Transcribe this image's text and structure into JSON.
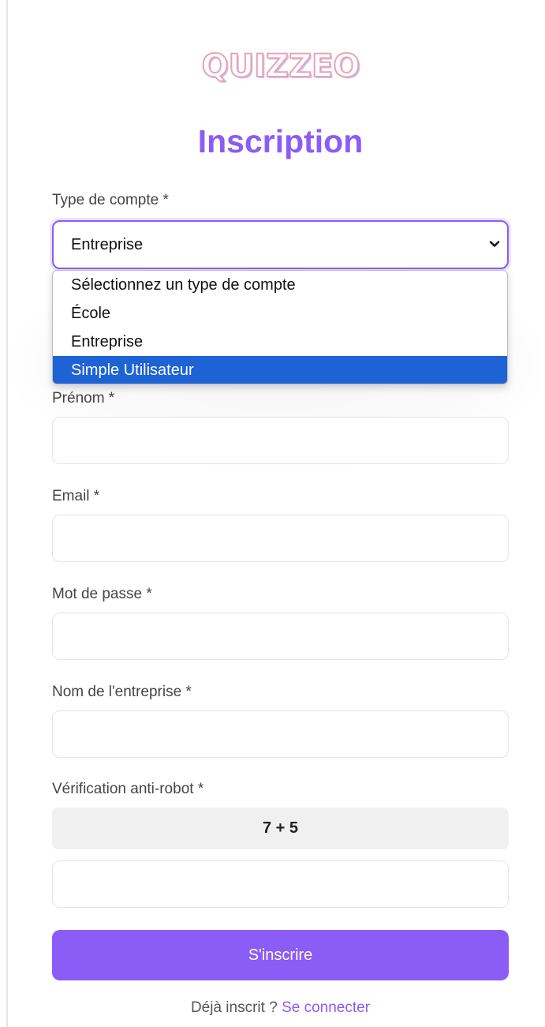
{
  "logo": {
    "text": "QUIZZEO"
  },
  "title": "Inscription",
  "account_type": {
    "label": "Type de compte *",
    "selected": "Entreprise",
    "options": [
      "Sélectionnez un type de compte",
      "École",
      "Entreprise",
      "Simple Utilisateur"
    ],
    "highlighted": "Simple Utilisateur"
  },
  "fields": {
    "prenom": {
      "label": "Prénom *",
      "value": ""
    },
    "email": {
      "label": "Email *",
      "value": ""
    },
    "password": {
      "label": "Mot de passe *",
      "value": ""
    },
    "company": {
      "label": "Nom de l'entreprise *",
      "value": ""
    },
    "captcha": {
      "label": "Vérification anti-robot *",
      "question": "7 + 5",
      "value": ""
    }
  },
  "submit_label": "S'inscrire",
  "footer": {
    "text": "Déjà inscrit ? ",
    "link": "Se connecter"
  },
  "colors": {
    "accent": "#8b5cf6",
    "highlight": "#1e63d6"
  }
}
